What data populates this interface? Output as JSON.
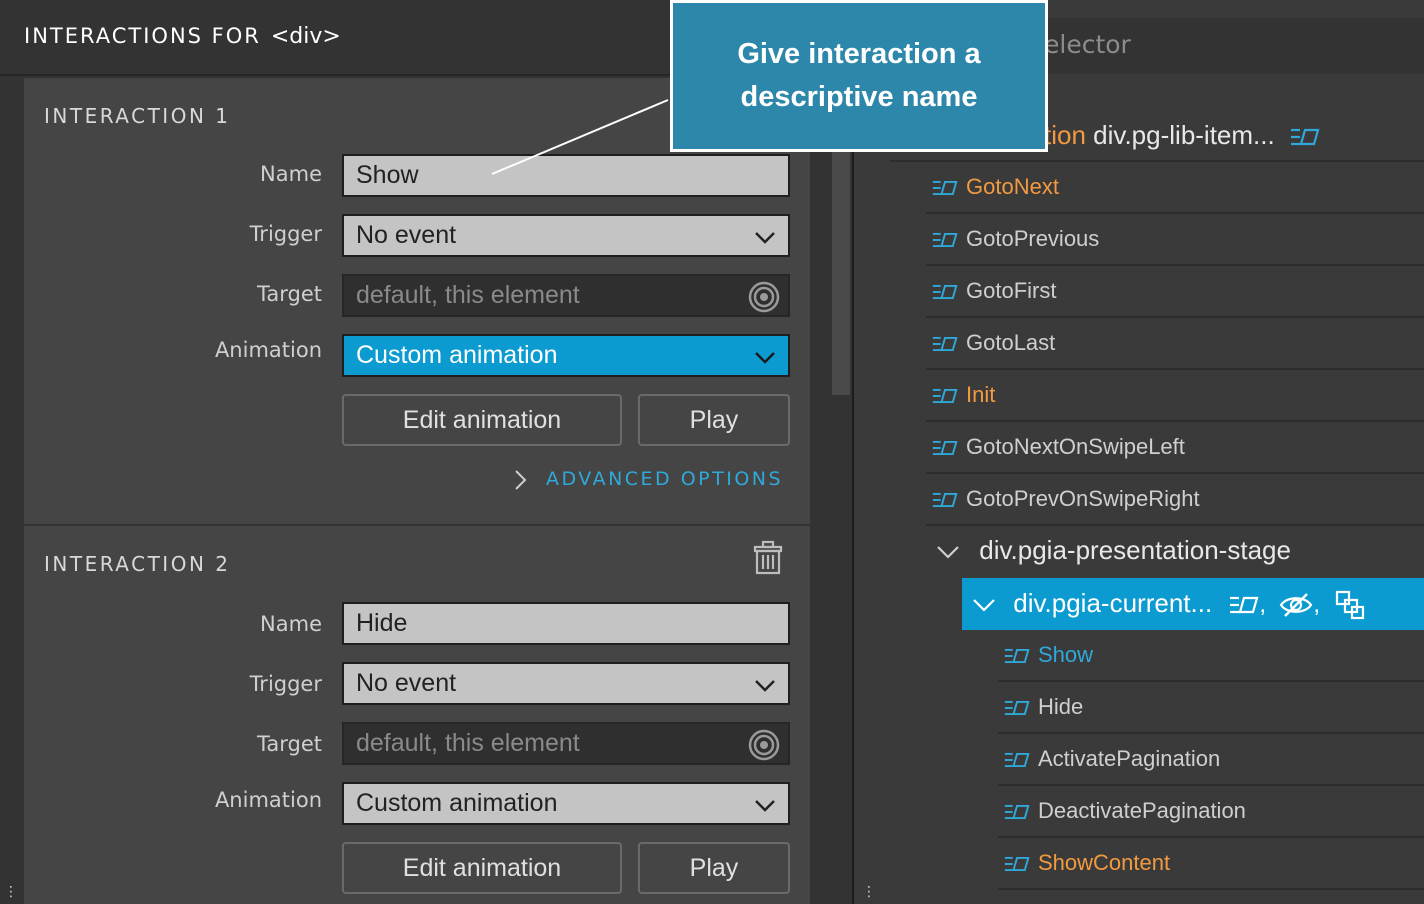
{
  "left_panel": {
    "title": "INTERACTIONS FOR",
    "title_tag": "<div>",
    "interactions": [
      {
        "heading": "INTERACTION 1",
        "name_label": "Name",
        "name_value": "Show",
        "trigger_label": "Trigger",
        "trigger_value": "No event",
        "target_label": "Target",
        "target_placeholder": "default, this element",
        "animation_label": "Animation",
        "animation_value": "Custom animation",
        "edit_button": "Edit animation",
        "play_button": "Play",
        "advanced_label": "ADVANCED OPTIONS"
      },
      {
        "heading": "INTERACTION 2",
        "name_label": "Name",
        "name_value": "Hide",
        "trigger_label": "Trigger",
        "trigger_value": "No event",
        "target_label": "Target",
        "target_placeholder": "default, this element",
        "animation_label": "Animation",
        "animation_value": "Custom animation",
        "edit_button": "Edit animation",
        "play_button": "Play"
      }
    ]
  },
  "callout": {
    "line1": "Give interaction a",
    "line2": "descriptive name"
  },
  "right_panel": {
    "selector_text": "elector",
    "root_row": {
      "prefix": "tion",
      "name": "div.pg-lib-item..."
    },
    "actions": [
      {
        "label": "GotoNext",
        "color": "#f29a3f"
      },
      {
        "label": "GotoPrevious",
        "color": "#cfcfcf"
      },
      {
        "label": "GotoFirst",
        "color": "#cfcfcf"
      },
      {
        "label": "GotoLast",
        "color": "#cfcfcf"
      },
      {
        "label": "Init",
        "color": "#f29a3f"
      },
      {
        "label": "GotoNextOnSwipeLeft",
        "color": "#cfcfcf"
      },
      {
        "label": "GotoPrevOnSwipeRight",
        "color": "#cfcfcf"
      }
    ],
    "stage_row": "div.pgia-presentation-stage",
    "current_row": "div.pgia-current...",
    "current_actions": [
      {
        "label": "Show",
        "color": "#2fa9d9"
      },
      {
        "label": "Hide",
        "color": "#cfcfcf"
      },
      {
        "label": "ActivatePagination",
        "color": "#cfcfcf"
      },
      {
        "label": "DeactivatePagination",
        "color": "#cfcfcf"
      },
      {
        "label": "ShowContent",
        "color": "#f29a3f"
      }
    ]
  },
  "colors": {
    "accent": "#0b9bd0",
    "orange": "#f29a3f",
    "callout": "#2d87aa"
  }
}
